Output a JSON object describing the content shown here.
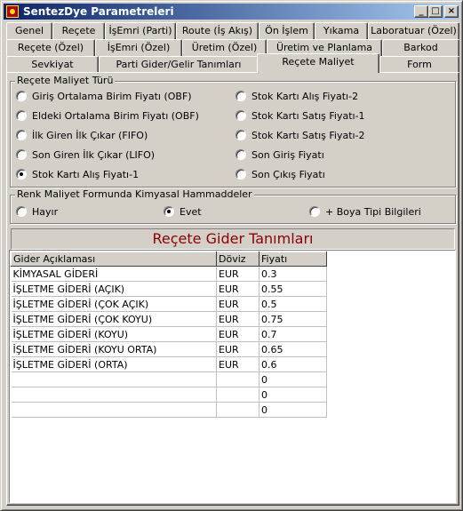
{
  "window": {
    "title": "SentezDye Parametreleri",
    "minimize": "_",
    "maximize": "□",
    "close": "×"
  },
  "tabs": {
    "row1": [
      "Genel",
      "Reçete",
      "İşEmri (Parti)",
      "Route (İş Akış)",
      "Ön İşlem",
      "Yıkama",
      "Laboratuar (Özel)"
    ],
    "row2": [
      "Reçete (Özel)",
      "İşEmri (Özel)",
      "Üretim (Özel)",
      "Üretim ve Planlama",
      "Barkod"
    ],
    "row3": [
      "Sevkiyat",
      "Parti Gider/Gelir Tanımları",
      "Reçete Maliyet",
      "Form"
    ],
    "active": "Reçete Maliyet"
  },
  "recete_maliyet_turu": {
    "legend": "Reçete Maliyet Türü",
    "options": [
      "Giriş Ortalama Birim Fiyatı (OBF)",
      "Eldeki Ortalama Birim Fiyatı (OBF)",
      "İlk Giren İlk Çıkar (FIFO)",
      "Son Giren İlk Çıkar (LIFO)",
      "Stok Kartı Alış Fiyatı-1",
      "Stok Kartı Alış Fiyatı-2",
      "Stok Kartı Satış Fiyatı-1",
      "Stok Kartı Satış Fiyatı-2",
      "Son Giriş Fiyatı",
      "Son Çıkış Fiyatı"
    ],
    "selected": "Stok Kartı Alış Fiyatı-1"
  },
  "renk_maliyet": {
    "legend": "Renk Maliyet Formunda Kimyasal Hammaddeler",
    "options": [
      "Hayır",
      "Evet",
      "+ Boya Tipi Bilgileri"
    ],
    "selected": "Evet"
  },
  "gider": {
    "banner": "Reçete Gider Tanımları",
    "columns": [
      "Gider Açıklaması",
      "Döviz",
      "Fiyatı"
    ],
    "rows": [
      [
        "KİMYASAL GİDERİ",
        "EUR",
        "0.3"
      ],
      [
        "İŞLETME GİDERİ (AÇIK)",
        "EUR",
        "0.55"
      ],
      [
        "İŞLETME GİDERİ (ÇOK AÇIK)",
        "EUR",
        "0.5"
      ],
      [
        "İŞLETME GİDERİ (ÇOK KOYU)",
        "EUR",
        "0.75"
      ],
      [
        "İŞLETME GİDERİ (KOYU)",
        "EUR",
        "0.7"
      ],
      [
        "İŞLETME GİDERİ (KOYU ORTA)",
        "EUR",
        "0.65"
      ],
      [
        "İŞLETME GİDERİ (ORTA)",
        "EUR",
        "0.6"
      ],
      [
        "",
        "",
        "0"
      ],
      [
        "",
        "",
        "0"
      ],
      [
        "",
        "",
        "0"
      ]
    ]
  }
}
